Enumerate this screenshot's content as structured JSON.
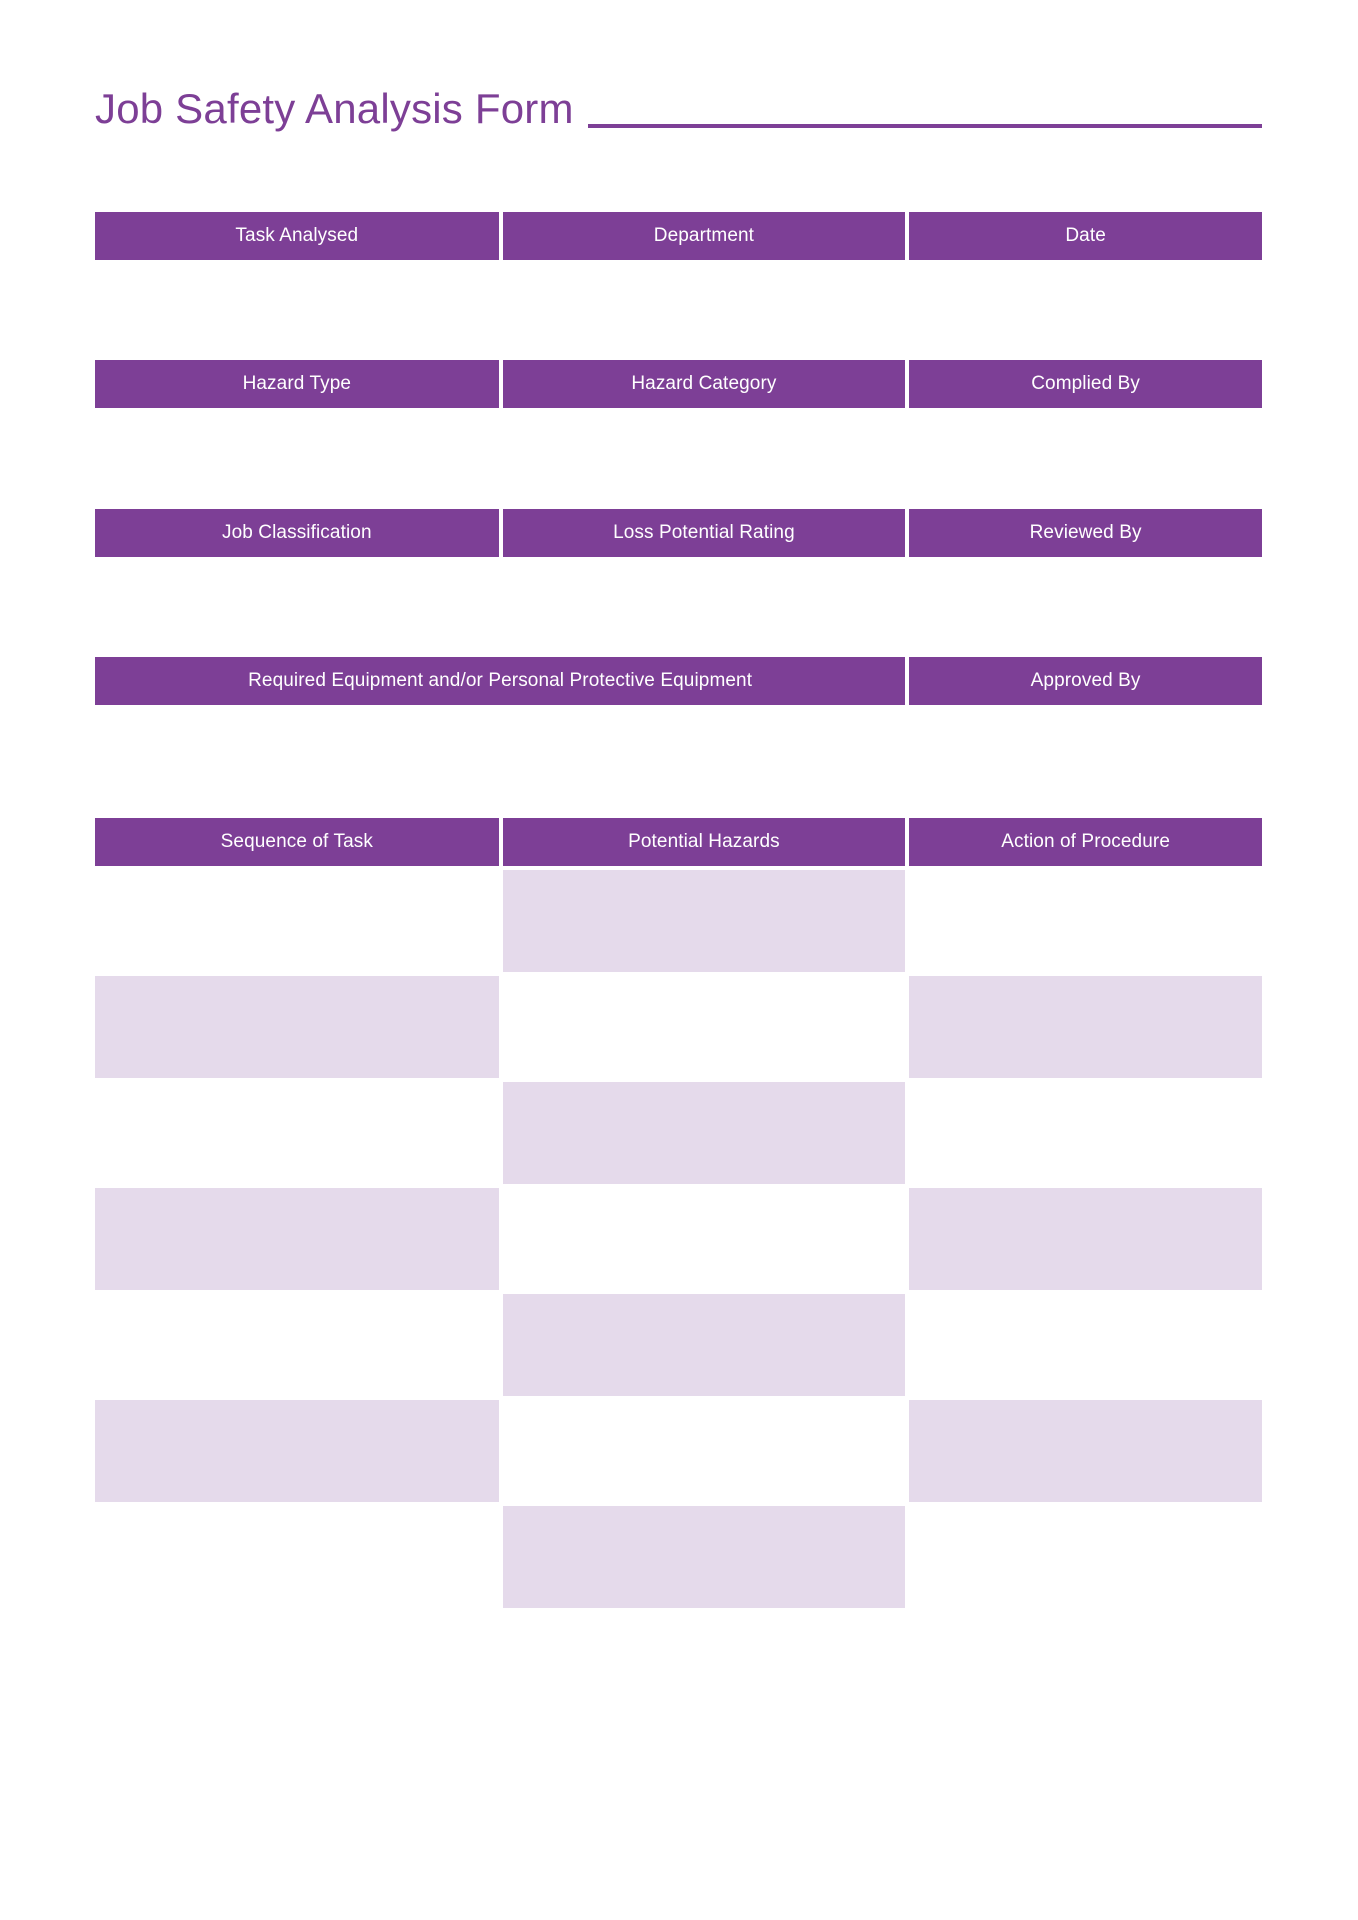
{
  "document": {
    "title": "Job Safety Analysis Form"
  },
  "colors": {
    "header_purple": "#7D3F96",
    "cell_lavender": "#E5DAEB",
    "page_background": "#FFFFFF",
    "title_purple": "#7D3F96"
  },
  "field_rows": [
    {
      "id": "row-task",
      "cells": [
        {
          "label": "Task Analysed",
          "span": 1
        },
        {
          "label": "Department",
          "span": 1
        },
        {
          "label": "Date",
          "span": 1
        }
      ]
    },
    {
      "id": "row-hazard",
      "cells": [
        {
          "label": "Hazard Type",
          "span": 1
        },
        {
          "label": "Hazard Category",
          "span": 1
        },
        {
          "label": "Complied By",
          "span": 1
        }
      ]
    },
    {
      "id": "row-classification",
      "cells": [
        {
          "label": "Job Classification",
          "span": 1
        },
        {
          "label": "Loss Potential Rating",
          "span": 1
        },
        {
          "label": "Reviewed By",
          "span": 1
        }
      ]
    },
    {
      "id": "row-equipment",
      "cells": [
        {
          "label": "Required Equipment and/or Personal Protective Equipment",
          "span": 2
        },
        {
          "label": "Approved By",
          "span": 1
        }
      ]
    }
  ],
  "task_table": {
    "headers": [
      "Sequence of Task",
      "Potential Hazards",
      "Action of Procedure"
    ],
    "rows": [
      {
        "values": [
          "",
          "",
          ""
        ],
        "shading": [
          "blank",
          "fill",
          "blank"
        ]
      },
      {
        "values": [
          "",
          "",
          ""
        ],
        "shading": [
          "fill",
          "blank",
          "fill"
        ]
      },
      {
        "values": [
          "",
          "",
          ""
        ],
        "shading": [
          "blank",
          "fill",
          "blank"
        ]
      },
      {
        "values": [
          "",
          "",
          ""
        ],
        "shading": [
          "fill",
          "blank",
          "fill"
        ]
      },
      {
        "values": [
          "",
          "",
          ""
        ],
        "shading": [
          "blank",
          "fill",
          "blank"
        ]
      },
      {
        "values": [
          "",
          "",
          ""
        ],
        "shading": [
          "fill",
          "blank",
          "fill"
        ]
      },
      {
        "values": [
          "",
          "",
          ""
        ],
        "shading": [
          "blank",
          "fill",
          "blank"
        ]
      }
    ]
  }
}
